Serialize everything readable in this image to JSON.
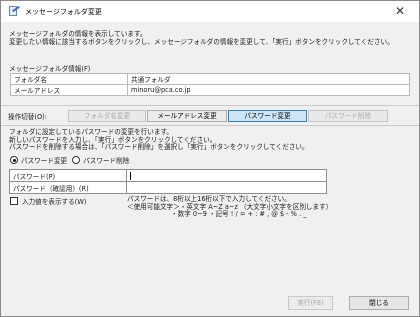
{
  "window": {
    "title": "メッセージフォルダ変更"
  },
  "intro": {
    "line1": "メッセージフォルダの情報を表示しています。",
    "line2": "変更したい情報に該当するボタンをクリックし、メッセージフォルダの情報を変更して、「実行」ボタンをクリックしてください。"
  },
  "info": {
    "section_label": "メッセージフォルダ情報(F)",
    "rows": [
      {
        "key": "フォルダ名",
        "value": "共通フォルダ"
      },
      {
        "key": "メールアドレス",
        "value": "minoru@pca.co.jp"
      }
    ]
  },
  "operation": {
    "label": "操作切替(O):",
    "buttons": [
      {
        "label": "フォルダ名変更",
        "state": "disabled"
      },
      {
        "label": "メールアドレス変更",
        "state": "enabled"
      },
      {
        "label": "パスワード変更",
        "state": "active"
      },
      {
        "label": "パスワード削除",
        "state": "disabled"
      }
    ]
  },
  "desc": {
    "line1": "フォルダに設定しているパスワードの変更を行います。",
    "line2": "新しいパスワードを入力し、「実行」ボタンをクリックしてください。",
    "line3": "パスワードを削除する場合は、「パスワード削除」を選択し「実行」ボタンをクリックしてください。"
  },
  "radios": {
    "change_label": "パスワード変更",
    "delete_label": "パスワード削除",
    "selected": "change"
  },
  "password": {
    "label": "パスワード(P)",
    "value": "",
    "confirm_label": "パスワード（確認用）(R)",
    "confirm_value": ""
  },
  "show_input": {
    "label": "入力値を表示する(W)",
    "checked": false
  },
  "hint": {
    "line1": "パスワードは、8桁以上16桁以下で入力してください。",
    "line2": "＜使用可能文字＞・英文字 A~Z a~z （大文字小文字を区別します）",
    "line3": "・数字 0~9 ・記号 ! / = + : # , @ $ - % . _"
  },
  "footer": {
    "execute_label": "実行(F8)",
    "close_label": "閉じる"
  }
}
